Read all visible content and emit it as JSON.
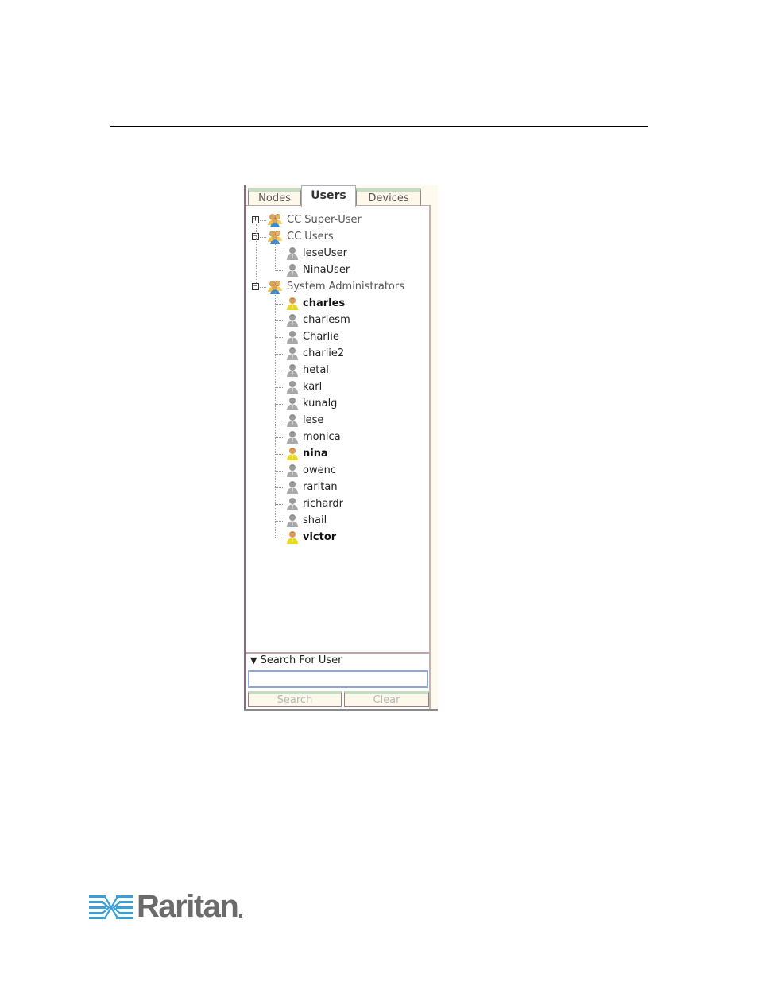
{
  "panel": {
    "tabs": [
      {
        "label": "Nodes",
        "active": false
      },
      {
        "label": "Users",
        "active": true
      },
      {
        "label": "Devices",
        "active": false
      }
    ],
    "tree": {
      "groups": [
        {
          "label": "CC Super-User",
          "expanded": false,
          "expander": "+",
          "icon": "user-group-icon",
          "children": []
        },
        {
          "label": "CC Users",
          "expanded": true,
          "expander": "−",
          "icon": "user-group-icon",
          "children": [
            {
              "label": "leseUser",
              "bold": false,
              "icon": "user-inactive-icon"
            },
            {
              "label": "NinaUser",
              "bold": false,
              "icon": "user-inactive-icon"
            }
          ]
        },
        {
          "label": "System Administrators",
          "expanded": true,
          "expander": "−",
          "icon": "user-group-icon",
          "children": [
            {
              "label": "charles",
              "bold": true,
              "icon": "user-active-icon"
            },
            {
              "label": "charlesm",
              "bold": false,
              "icon": "user-inactive-icon"
            },
            {
              "label": "Charlie",
              "bold": false,
              "icon": "user-inactive-icon"
            },
            {
              "label": "charlie2",
              "bold": false,
              "icon": "user-inactive-icon"
            },
            {
              "label": "hetal",
              "bold": false,
              "icon": "user-inactive-icon"
            },
            {
              "label": "karl",
              "bold": false,
              "icon": "user-inactive-icon"
            },
            {
              "label": "kunalg",
              "bold": false,
              "icon": "user-inactive-icon"
            },
            {
              "label": "lese",
              "bold": false,
              "icon": "user-inactive-icon"
            },
            {
              "label": "monica",
              "bold": false,
              "icon": "user-inactive-icon"
            },
            {
              "label": "nina",
              "bold": true,
              "icon": "user-active-icon"
            },
            {
              "label": "owenc",
              "bold": false,
              "icon": "user-inactive-icon"
            },
            {
              "label": "raritan",
              "bold": false,
              "icon": "user-inactive-icon"
            },
            {
              "label": "richardr",
              "bold": false,
              "icon": "user-inactive-icon"
            },
            {
              "label": "shail",
              "bold": false,
              "icon": "user-inactive-icon"
            },
            {
              "label": "victor",
              "bold": true,
              "icon": "user-active-icon"
            }
          ]
        }
      ]
    },
    "search": {
      "title": "Search For User",
      "toggle_glyph": "▼",
      "input_value": "",
      "input_placeholder": "",
      "search_label": "Search",
      "clear_label": "Clear"
    }
  },
  "footer": {
    "logo_text": "Raritan"
  },
  "colors": {
    "active_user": "#e0c020",
    "inactive_user": "#9a9a9a",
    "tab_accent": "#c3dcc3",
    "search_input_border": "#8fa6dc",
    "logo_blue": "#3aa0d8",
    "logo_gray": "#6b6b6b"
  }
}
